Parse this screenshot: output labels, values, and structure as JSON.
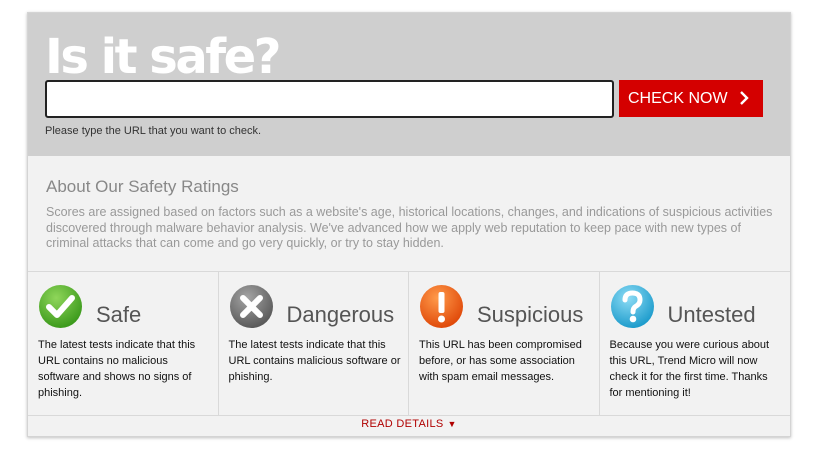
{
  "hero": {
    "title": "Is it safe?",
    "input_value": "",
    "check_button": "CHECK NOW",
    "hint": "Please type the URL that you want to check."
  },
  "about": {
    "title": "About Our Safety Ratings",
    "text": "Scores are assigned based on factors such as a website's age, historical locations, changes, and indications of suspicious activities discovered through malware behavior analysis. We've advanced how we apply web reputation to keep pace with new types of criminal attacks that can come and go very quickly, or try to stay hidden."
  },
  "ratings": [
    {
      "label": "Safe",
      "icon": "checkmark-icon",
      "color": "#4caf2a",
      "desc": "The latest tests indicate that this URL contains no malicious software and shows no signs of phishing."
    },
    {
      "label": "Dangerous",
      "icon": "x-icon",
      "color": "#666666",
      "desc": "The latest tests indicate that this URL contains malicious software or phishing."
    },
    {
      "label": "Suspicious",
      "icon": "exclamation-icon",
      "color": "#ee5a12",
      "desc": "This URL has been compromised before, or has some association with spam email messages."
    },
    {
      "label": "Untested",
      "icon": "question-icon",
      "color": "#2aa9d8",
      "desc": "Because you were curious about this URL, Trend Micro will now check it for the first time. Thanks for mentioning it!"
    }
  ],
  "read_details": "READ DETAILS",
  "colors": {
    "accent": "#d40000",
    "hero_bg": "#cfcfcf",
    "panel_bg": "#f2f2f2"
  }
}
